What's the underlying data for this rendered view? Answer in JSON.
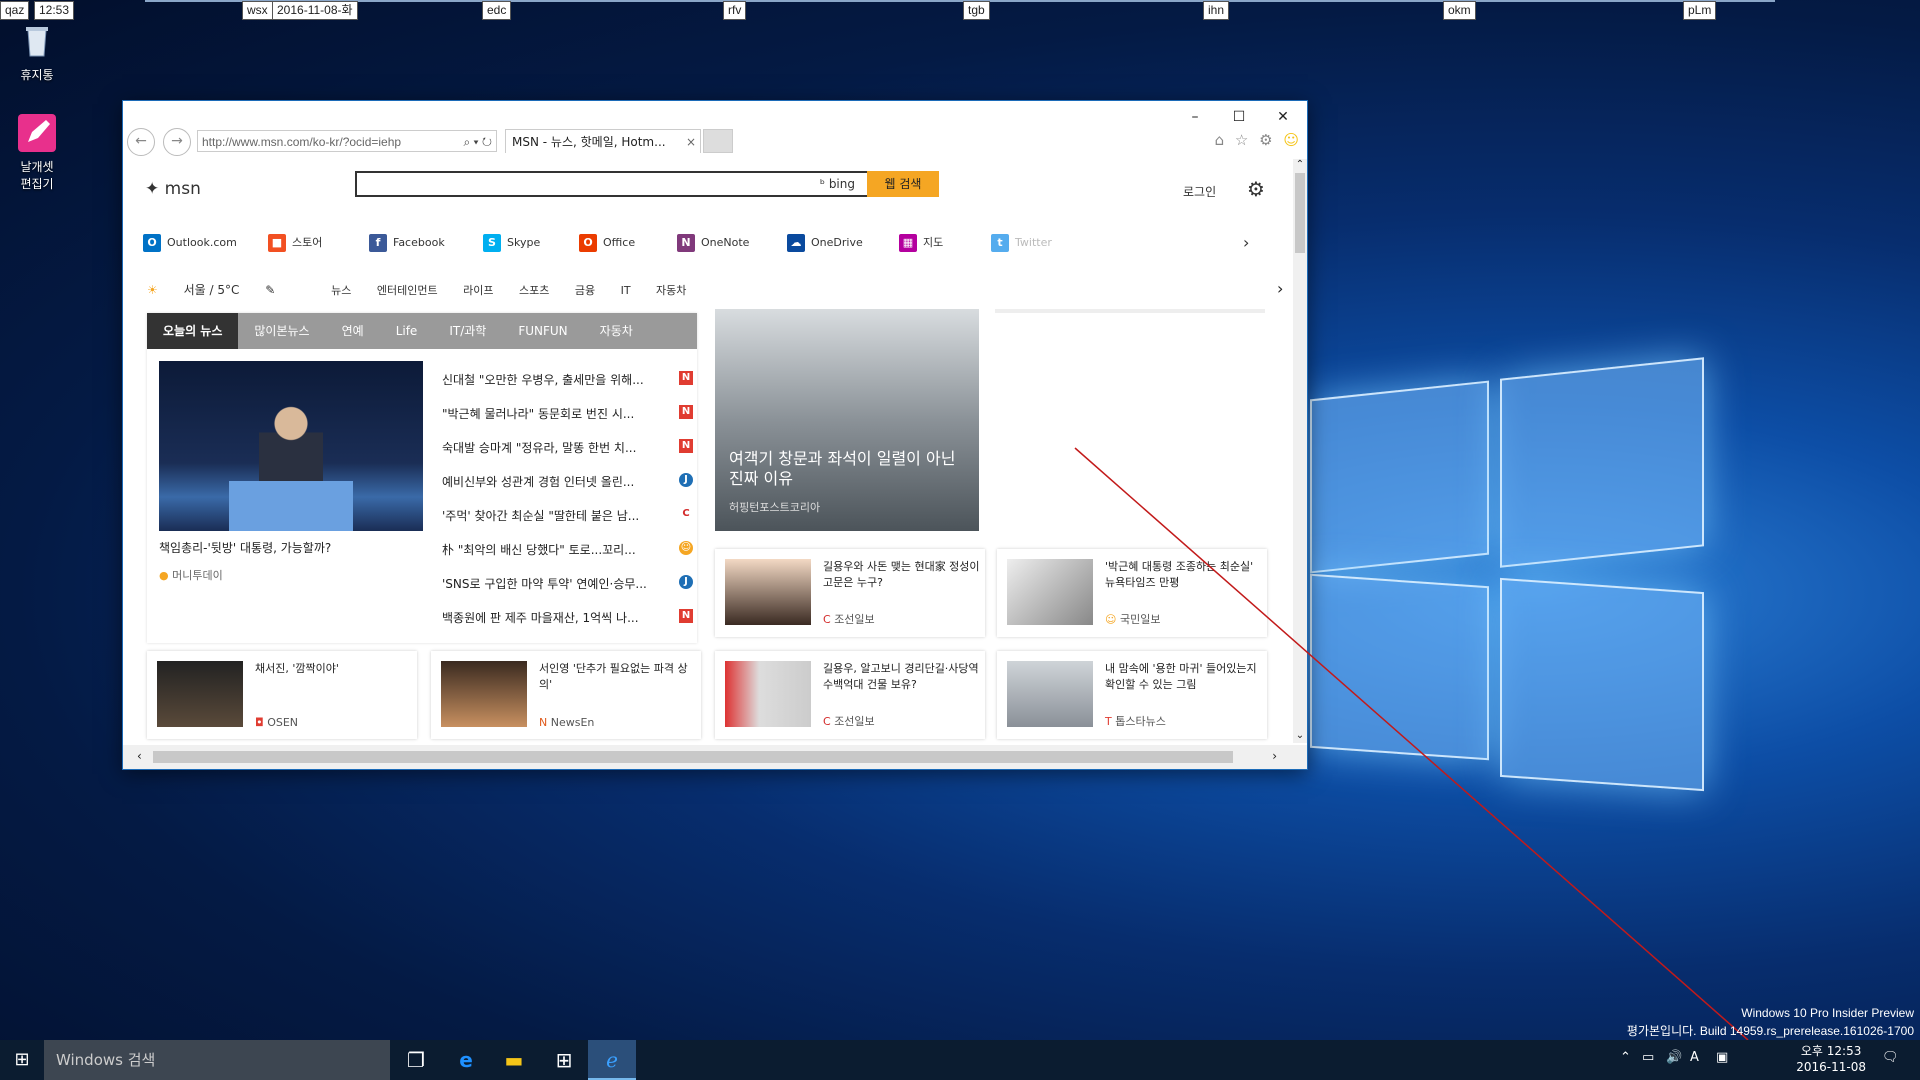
{
  "overlay_tags": [
    {
      "label": "qaz"
    },
    {
      "label": "12:53"
    },
    {
      "label": "wsx"
    },
    {
      "label": "2016-11-08-화"
    },
    {
      "label": "edc"
    },
    {
      "label": "rfv"
    },
    {
      "label": "tgb"
    },
    {
      "label": "ihn"
    },
    {
      "label": "okm"
    },
    {
      "label": "pLm"
    }
  ],
  "desktop": {
    "recycle_bin": "휴지통",
    "sticky_app_line1": "날개셋",
    "sticky_app_line2": "편집기"
  },
  "browser": {
    "address": "http://www.msn.com/ko-kr/?ocid=iehp",
    "tab_title": "MSN - 뉴스, 핫메일, Hotm...",
    "tab_close": "×",
    "controls": {
      "minimize": "–",
      "maximize": "☐",
      "close": "✕"
    }
  },
  "msn": {
    "logo": "msn",
    "search_placeholder": "",
    "bing": "bing",
    "search_button": "웹 검색",
    "login": "로그인",
    "apps": [
      {
        "label": "Outlook.com",
        "color": "#0072c6",
        "glyph": "O"
      },
      {
        "label": "스토어",
        "color": "#f25022",
        "glyph": "■"
      },
      {
        "label": "Facebook",
        "color": "#3b5998",
        "glyph": "f"
      },
      {
        "label": "Skype",
        "color": "#00aff0",
        "glyph": "S"
      },
      {
        "label": "Office",
        "color": "#eb3c00",
        "glyph": "O"
      },
      {
        "label": "OneNote",
        "color": "#80397b",
        "glyph": "N"
      },
      {
        "label": "OneDrive",
        "color": "#0a4a9e",
        "glyph": "☁"
      },
      {
        "label": "지도",
        "color": "#b4009e",
        "glyph": "▦"
      },
      {
        "label": "Twitter",
        "color": "#55acee",
        "glyph": "t"
      }
    ],
    "weather": "서울 / 5°C",
    "subnav": [
      "뉴스",
      "엔터테인먼트",
      "라이프",
      "스포츠",
      "금융",
      "IT",
      "자동차"
    ],
    "news_tabs": [
      "오늘의 뉴스",
      "많이본뉴스",
      "연예",
      "Life",
      "IT/과학",
      "FUNFUN",
      "자동차"
    ],
    "main_caption": "책임총리-'뒷방' 대통령, 가능할까?",
    "main_source": "머니투데이",
    "headlines": [
      {
        "text": "신대철 \"오만한 우병우, 출세만을 위해...",
        "icon": "N",
        "color": "#e03c31"
      },
      {
        "text": "\"박근혜 물러나라\" 동문회로 번진 시...",
        "icon": "N",
        "color": "#e03c31"
      },
      {
        "text": "숙대발 승마계 \"정유라, 말똥 한번 치...",
        "icon": "N",
        "color": "#e03c31"
      },
      {
        "text": "예비신부와 성관계 경험 인터넷 올린...",
        "icon": "J",
        "color": "#1f6fb5"
      },
      {
        "text": "'주먹' 찾아간 최순실 \"딸한테 붙은 남...",
        "icon": "C",
        "color": "#d32b2b"
      },
      {
        "text": "朴 \"최악의 배신 당했다\" 토로...꼬리...",
        "icon": "☺",
        "color": "#f5a623"
      },
      {
        "text": "'SNS로 구입한 마약 투약' 연예인·승무...",
        "icon": "J",
        "color": "#1f6fb5"
      },
      {
        "text": "백종원에 판 제주 마을재산, 1억씩 나...",
        "icon": "N",
        "color": "#e03c31"
      }
    ],
    "feature": {
      "title": "여객기 창문과 좌석이 일렬이 아닌 진짜 이유",
      "source": "허핑턴포스트코리아"
    },
    "cards": [
      {
        "title": "길용우와 사돈 맺는 현대家 정성이 고문은 누구?",
        "source": "조선일보"
      },
      {
        "title": "'박근혜 대통령 조종하는 최순실' 뉴욕타임즈 만평",
        "source": "국민일보"
      },
      {
        "title": "채서진, '깜짝이야'",
        "source": "OSEN"
      },
      {
        "title": "서인영 '단추가 필요없는 파격 상의'",
        "source": "NewsEn"
      },
      {
        "title": "길용우, 알고보니 경리단길·사당역 수백억대 건물 보유?",
        "source": "조선일보"
      },
      {
        "title": "내 맘속에 '용한 마귀' 들어있는지 확인할 수 있는 그림",
        "source": "톱스타뉴스"
      }
    ]
  },
  "watermark": {
    "line1": "Windows 10 Pro Insider Preview",
    "line2": "평가본입니다. Build 14959.rs_prerelease.161026-1700"
  },
  "taskbar": {
    "search_placeholder": "Windows 검색",
    "time": "오후 12:53",
    "date": "2016-11-08",
    "notifications": "1"
  }
}
